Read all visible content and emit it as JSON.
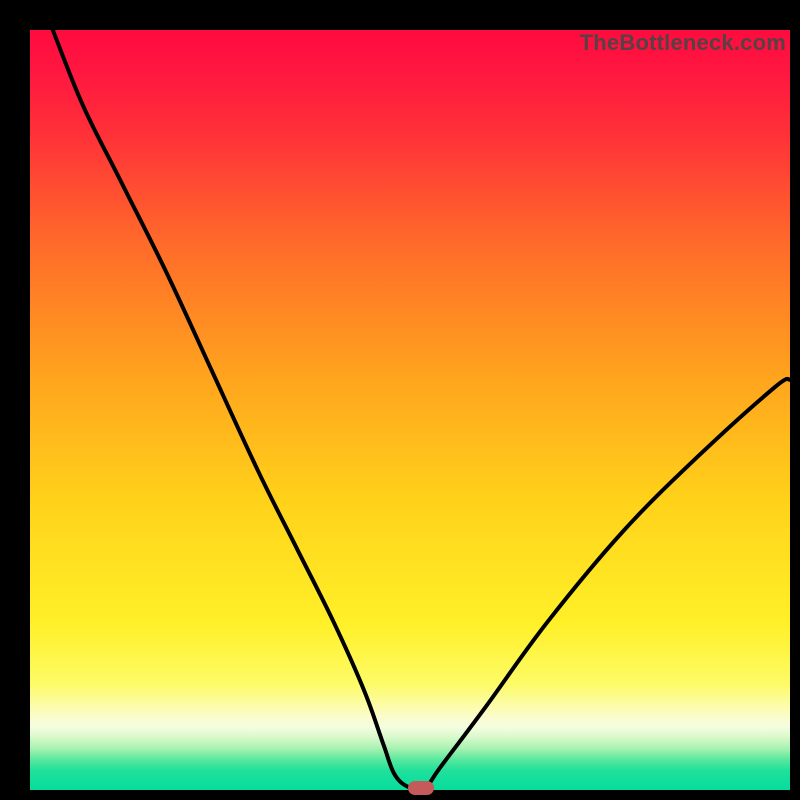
{
  "watermark": "TheBottleneck.com",
  "colors": {
    "bg": "#000000",
    "curve": "#000000",
    "marker": "#c45a5a",
    "grad_stops": [
      {
        "pos": 0.0,
        "color": "#ff0b3e"
      },
      {
        "pos": 0.06,
        "color": "#ff1840"
      },
      {
        "pos": 0.14,
        "color": "#ff3238"
      },
      {
        "pos": 0.28,
        "color": "#ff6a2a"
      },
      {
        "pos": 0.45,
        "color": "#ffa21e"
      },
      {
        "pos": 0.62,
        "color": "#ffd21a"
      },
      {
        "pos": 0.78,
        "color": "#fff028"
      },
      {
        "pos": 0.86,
        "color": "#fdfb66"
      },
      {
        "pos": 0.905,
        "color": "#fbfccf"
      },
      {
        "pos": 0.918,
        "color": "#f3fde0"
      },
      {
        "pos": 0.93,
        "color": "#daf9cb"
      },
      {
        "pos": 0.945,
        "color": "#a9f2b2"
      },
      {
        "pos": 0.96,
        "color": "#58e89d"
      },
      {
        "pos": 0.975,
        "color": "#1fe09b"
      },
      {
        "pos": 1.0,
        "color": "#06dd9d"
      }
    ]
  },
  "chart_data": {
    "type": "line",
    "title": "",
    "xlabel": "",
    "ylabel": "",
    "x_range": [
      0,
      100
    ],
    "y_range": [
      0,
      100
    ],
    "series": [
      {
        "name": "bottleneck-curve",
        "x": [
          3,
          7,
          12,
          18,
          24,
          30,
          35,
          40,
          44,
          46.5,
          48,
          50,
          52,
          54,
          60,
          68,
          78,
          88,
          98,
          100
        ],
        "y": [
          100,
          90,
          80,
          68,
          55,
          42,
          32,
          22,
          13,
          6,
          2,
          0.3,
          0.3,
          3,
          11,
          22,
          34,
          44,
          53,
          54
        ]
      }
    ],
    "marker": {
      "x": 51.5,
      "y": 0.3
    },
    "notes": "V-shaped curve over vertical red→green heat gradient; minimum near x≈51; right arm rises to ~54% at x=100; left arm starts at 100% near x≈3."
  }
}
